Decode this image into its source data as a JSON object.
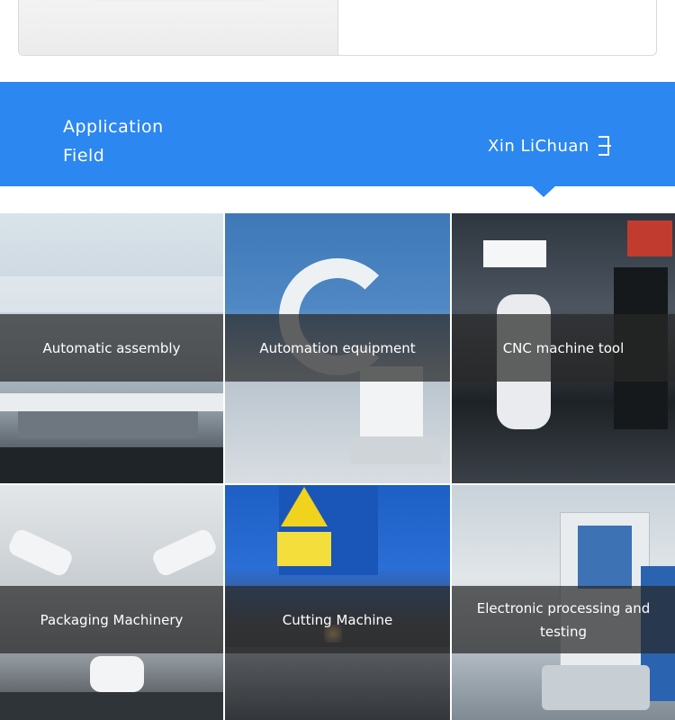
{
  "banner": {
    "title_line1": "Application",
    "title_line2": "Field",
    "brand": "Xin LiChuan",
    "background": "#2c87f0"
  },
  "tiles": [
    {
      "label": "Automatic assembly"
    },
    {
      "label": "Automation equipment"
    },
    {
      "label": "CNC machine tool"
    },
    {
      "label": "Packaging Machinery"
    },
    {
      "label": "Cutting Machine"
    },
    {
      "label": "Electronic processing and testing"
    }
  ]
}
